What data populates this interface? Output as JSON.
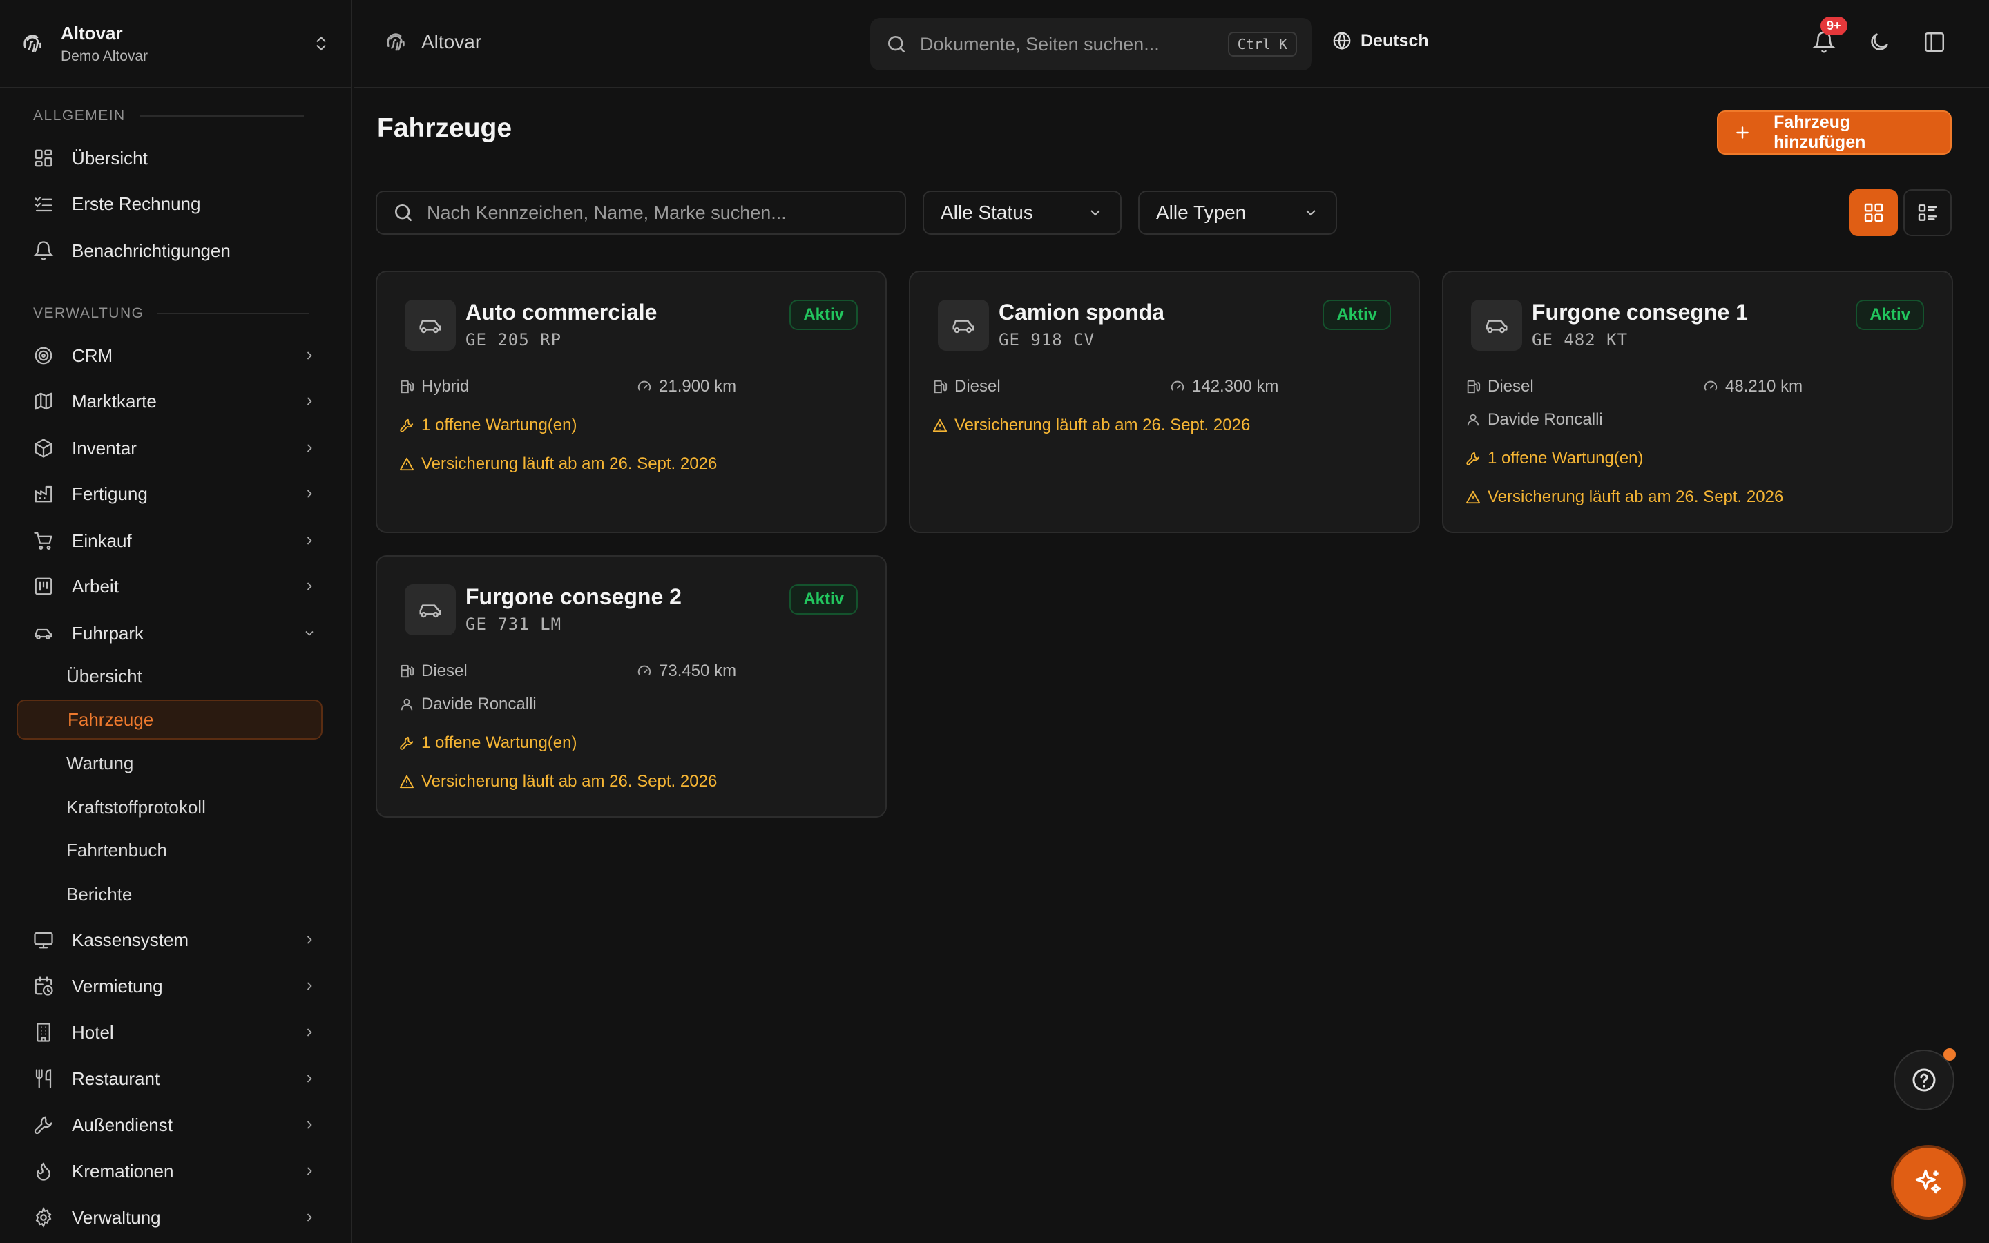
{
  "sidebar": {
    "org_name": "Altovar",
    "org_sub": "Demo Altovar",
    "section_general": "ALLGEMEIN",
    "section_admin": "VERWALTUNG",
    "general_items": [
      {
        "label": "Übersicht",
        "icon": "dashboard-icon"
      },
      {
        "label": "Erste Rechnung",
        "icon": "checklist-icon"
      },
      {
        "label": "Benachrichtigungen",
        "icon": "bell-icon"
      }
    ],
    "admin_items": [
      {
        "label": "CRM",
        "icon": "target-icon"
      },
      {
        "label": "Marktkarte",
        "icon": "map-icon"
      },
      {
        "label": "Inventar",
        "icon": "package-icon"
      },
      {
        "label": "Fertigung",
        "icon": "factory-icon"
      },
      {
        "label": "Einkauf",
        "icon": "cart-icon"
      },
      {
        "label": "Arbeit",
        "icon": "work-icon"
      },
      {
        "label": "Fuhrpark",
        "icon": "car-icon"
      }
    ],
    "fleet_sub": [
      "Übersicht",
      "Fahrzeuge",
      "Wartung",
      "Kraftstoffprotokoll",
      "Fahrtenbuch",
      "Berichte"
    ],
    "more_items": [
      {
        "label": "Kassensystem",
        "icon": "monitor-icon"
      },
      {
        "label": "Vermietung",
        "icon": "calendar-clock-icon"
      },
      {
        "label": "Hotel",
        "icon": "building-icon"
      },
      {
        "label": "Restaurant",
        "icon": "utensils-icon"
      },
      {
        "label": "Außendienst",
        "icon": "wrench-icon"
      },
      {
        "label": "Kremationen",
        "icon": "flame-icon"
      },
      {
        "label": "Verwaltung",
        "icon": "settings-icon"
      }
    ]
  },
  "topbar": {
    "breadcrumb": "Altovar",
    "search_placeholder": "Dokumente, Seiten suchen...",
    "shortcut": "Ctrl K",
    "language": "Deutsch",
    "notif_badge": "9+"
  },
  "page": {
    "title": "Fahrzeuge",
    "add_button": "Fahrzeug hinzufügen",
    "search_placeholder": "Nach Kennzeichen, Name, Marke suchen...",
    "status_filter": "Alle Status",
    "type_filter": "Alle Typen"
  },
  "vehicles": [
    {
      "name": "Auto commerciale",
      "plate": "GE 205 RP",
      "status": "Aktiv",
      "fuel": "Hybrid",
      "km": "21.900 km",
      "driver": "",
      "maintenance": "1 offene Wartung(en)",
      "insurance": "Versicherung läuft ab am 26. Sept. 2026"
    },
    {
      "name": "Camion sponda",
      "plate": "GE 918 CV",
      "status": "Aktiv",
      "fuel": "Diesel",
      "km": "142.300 km",
      "driver": "",
      "maintenance": "",
      "insurance": "Versicherung läuft ab am 26. Sept. 2026"
    },
    {
      "name": "Furgone consegne 1",
      "plate": "GE 482 KT",
      "status": "Aktiv",
      "fuel": "Diesel",
      "km": "48.210 km",
      "driver": "Davide Roncalli",
      "maintenance": "1 offene Wartung(en)",
      "insurance": "Versicherung läuft ab am 26. Sept. 2026"
    },
    {
      "name": "Furgone consegne 2",
      "plate": "GE 731 LM",
      "status": "Aktiv",
      "fuel": "Diesel",
      "km": "73.450 km",
      "driver": "Davide Roncalli",
      "maintenance": "1 offene Wartung(en)",
      "insurance": "Versicherung läuft ab am 26. Sept. 2026"
    }
  ],
  "colors": {
    "accent": "#e05e14",
    "status_active": "#22c55e",
    "warning": "#f5b534"
  }
}
